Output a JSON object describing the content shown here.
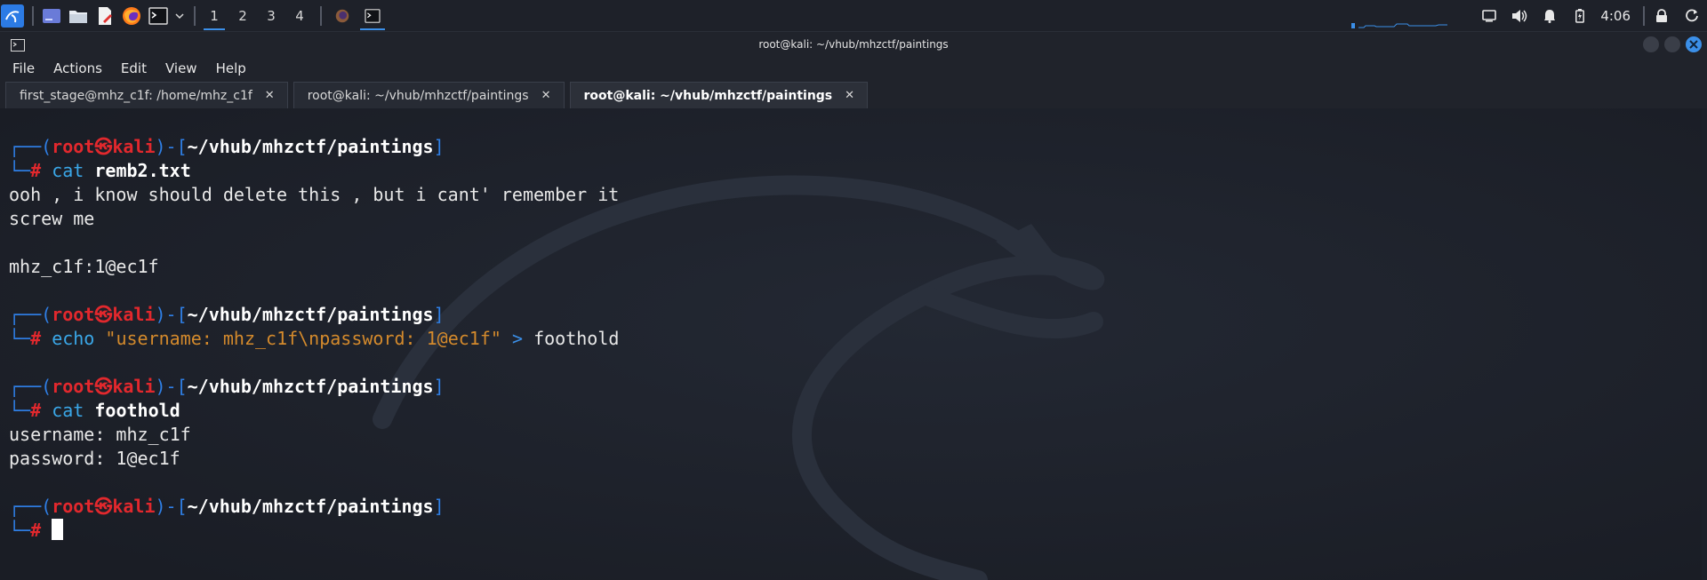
{
  "panel": {
    "workspaces": [
      "1",
      "2",
      "3",
      "4"
    ],
    "active_workspace": "1",
    "clock": "4:06",
    "icons": [
      "kali-menu-icon",
      "desktop-icon",
      "file-manager-icon",
      "text-editor-icon",
      "firefox-icon",
      "terminal-icon",
      "chevron-down-icon"
    ],
    "tray_icons": [
      "display-icon",
      "volume-icon",
      "notification-bell-icon",
      "battery-icon",
      "lock-icon",
      "power-icon"
    ]
  },
  "window": {
    "title": "root@kali: ~/vhub/mhzctf/paintings"
  },
  "menu": [
    "File",
    "Actions",
    "Edit",
    "View",
    "Help"
  ],
  "tabs": [
    {
      "label": "first_stage@mhz_c1f: /home/mhz_c1f",
      "close": "✕"
    },
    {
      "label": "root@kali: ~/vhub/mhzctf/paintings",
      "close": "✕"
    },
    {
      "label": "root@kali: ~/vhub/mhzctf/paintings",
      "close": "✕"
    }
  ],
  "terminal": {
    "prompt": {
      "open_top": "┌──(",
      "user": "root",
      "at": "㉿",
      "host": "kali",
      "mid": ")-[",
      "path": "~/vhub/mhzctf/paintings",
      "close": "]",
      "bottom": "└─",
      "hash": "#"
    },
    "blocks": [
      {
        "cmd": "cat",
        "arg": "remb2.txt",
        "output": [
          "ooh , i know should delete this , but i cant' remember it",
          "screw me",
          "",
          "mhz_c1f:1@ec1f"
        ]
      },
      {
        "cmd": "echo",
        "str": "\"username: mhz_c1f\\npassword: 1@ec1f\"",
        "op": ">",
        "target": "foothold"
      },
      {
        "cmd": "cat",
        "arg": "foothold",
        "output": [
          "username: mhz_c1f",
          "password: 1@ec1f"
        ]
      }
    ]
  }
}
